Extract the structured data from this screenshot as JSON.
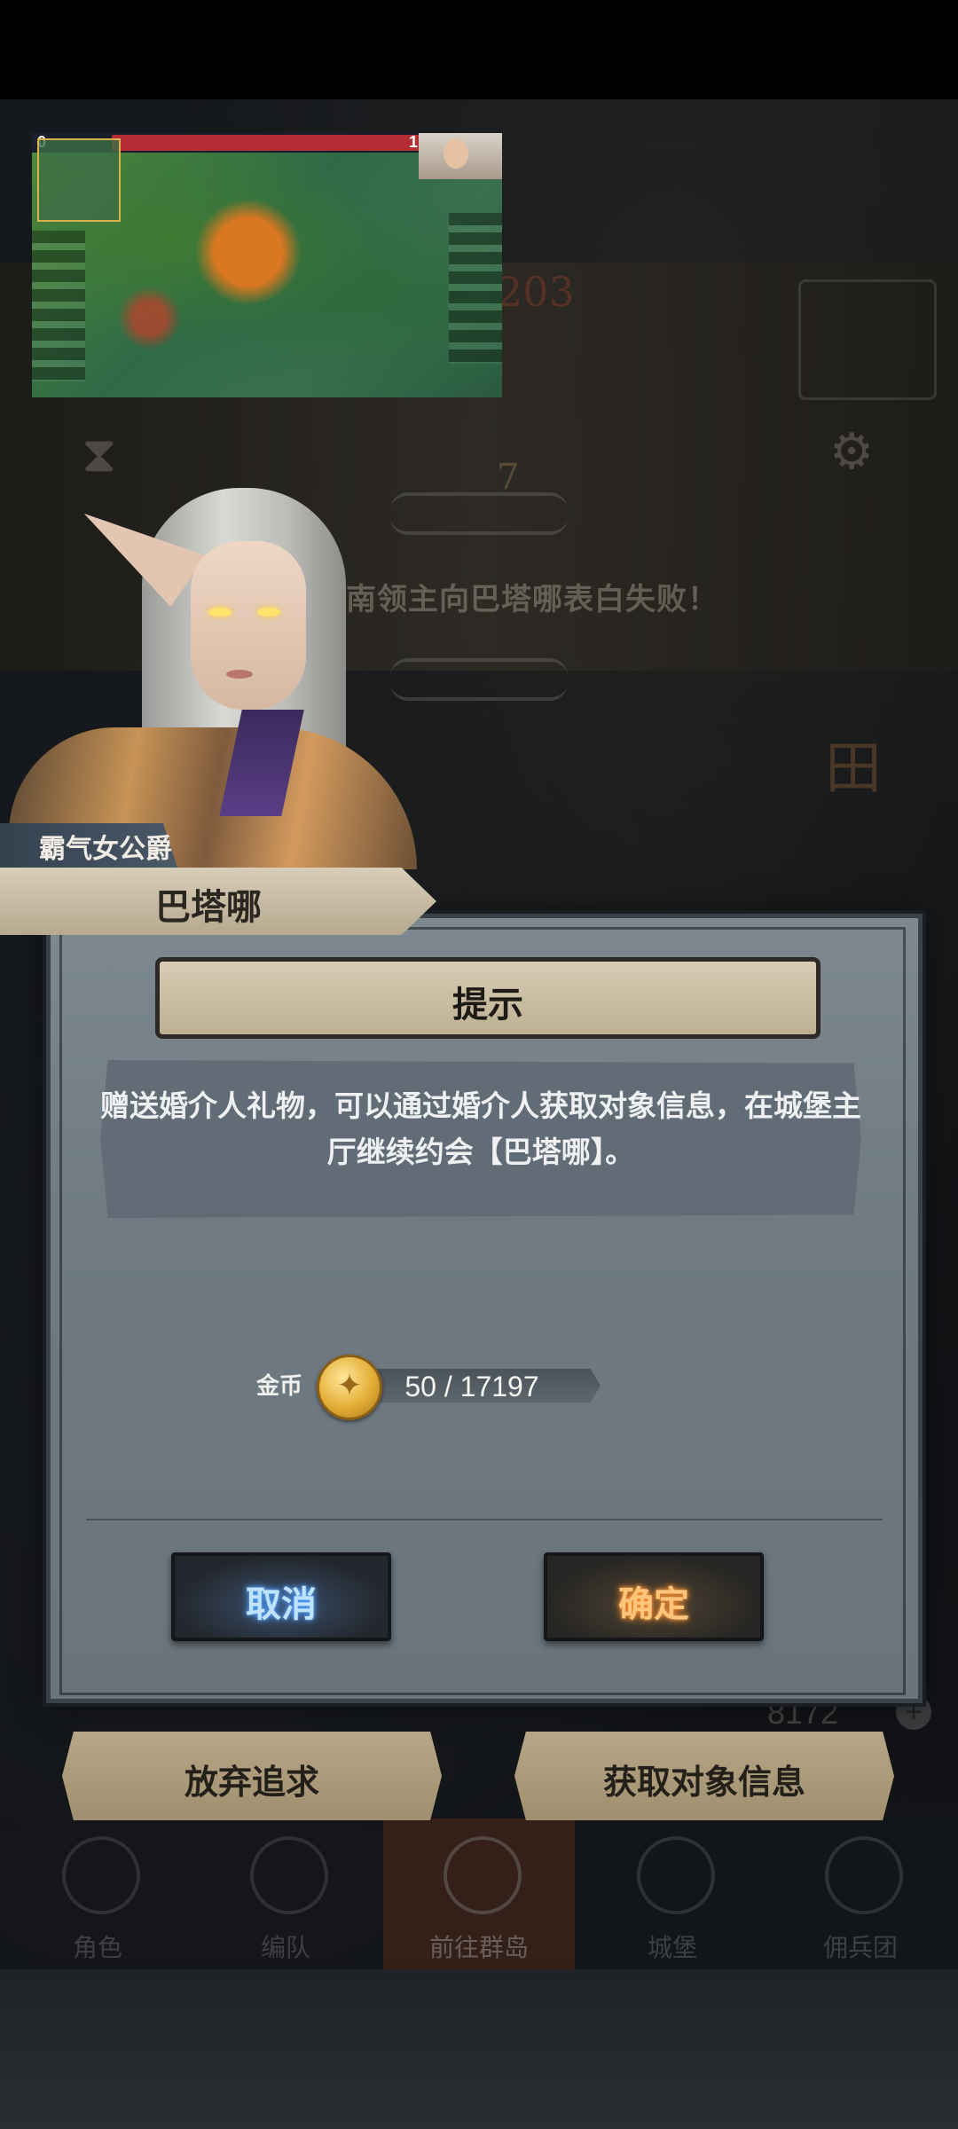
{
  "background": {
    "event_text": "南领主向巴塔哪表白失败！",
    "number_top": "203",
    "number_mid": "7",
    "gold_amount": "8172"
  },
  "stream": {
    "score_left": "0",
    "score_right": "1"
  },
  "character": {
    "title": "霸气女公爵",
    "name": "巴塔哪"
  },
  "dialog": {
    "title": "提示",
    "message": "赠送婚介人礼物，可以通过婚介人获取对象信息，在城堡主厅继续约会【巴塔哪】。",
    "cost_label": "金币",
    "cost_value": "50 / 17197",
    "cancel_label": "取消",
    "confirm_label": "确定"
  },
  "actions": {
    "abandon_label": "放弃追求",
    "get_info_label": "获取对象信息"
  },
  "nav": {
    "items": [
      {
        "label": "角色"
      },
      {
        "label": "编队"
      },
      {
        "label": "前往群岛"
      },
      {
        "label": "城堡"
      },
      {
        "label": "佣兵团"
      }
    ]
  },
  "colors": {
    "dialog_bg": "#78838b",
    "plate_bg": "#c9bda3",
    "cancel_glow": "#4a9bff",
    "confirm_glow": "#ff8c2a"
  }
}
